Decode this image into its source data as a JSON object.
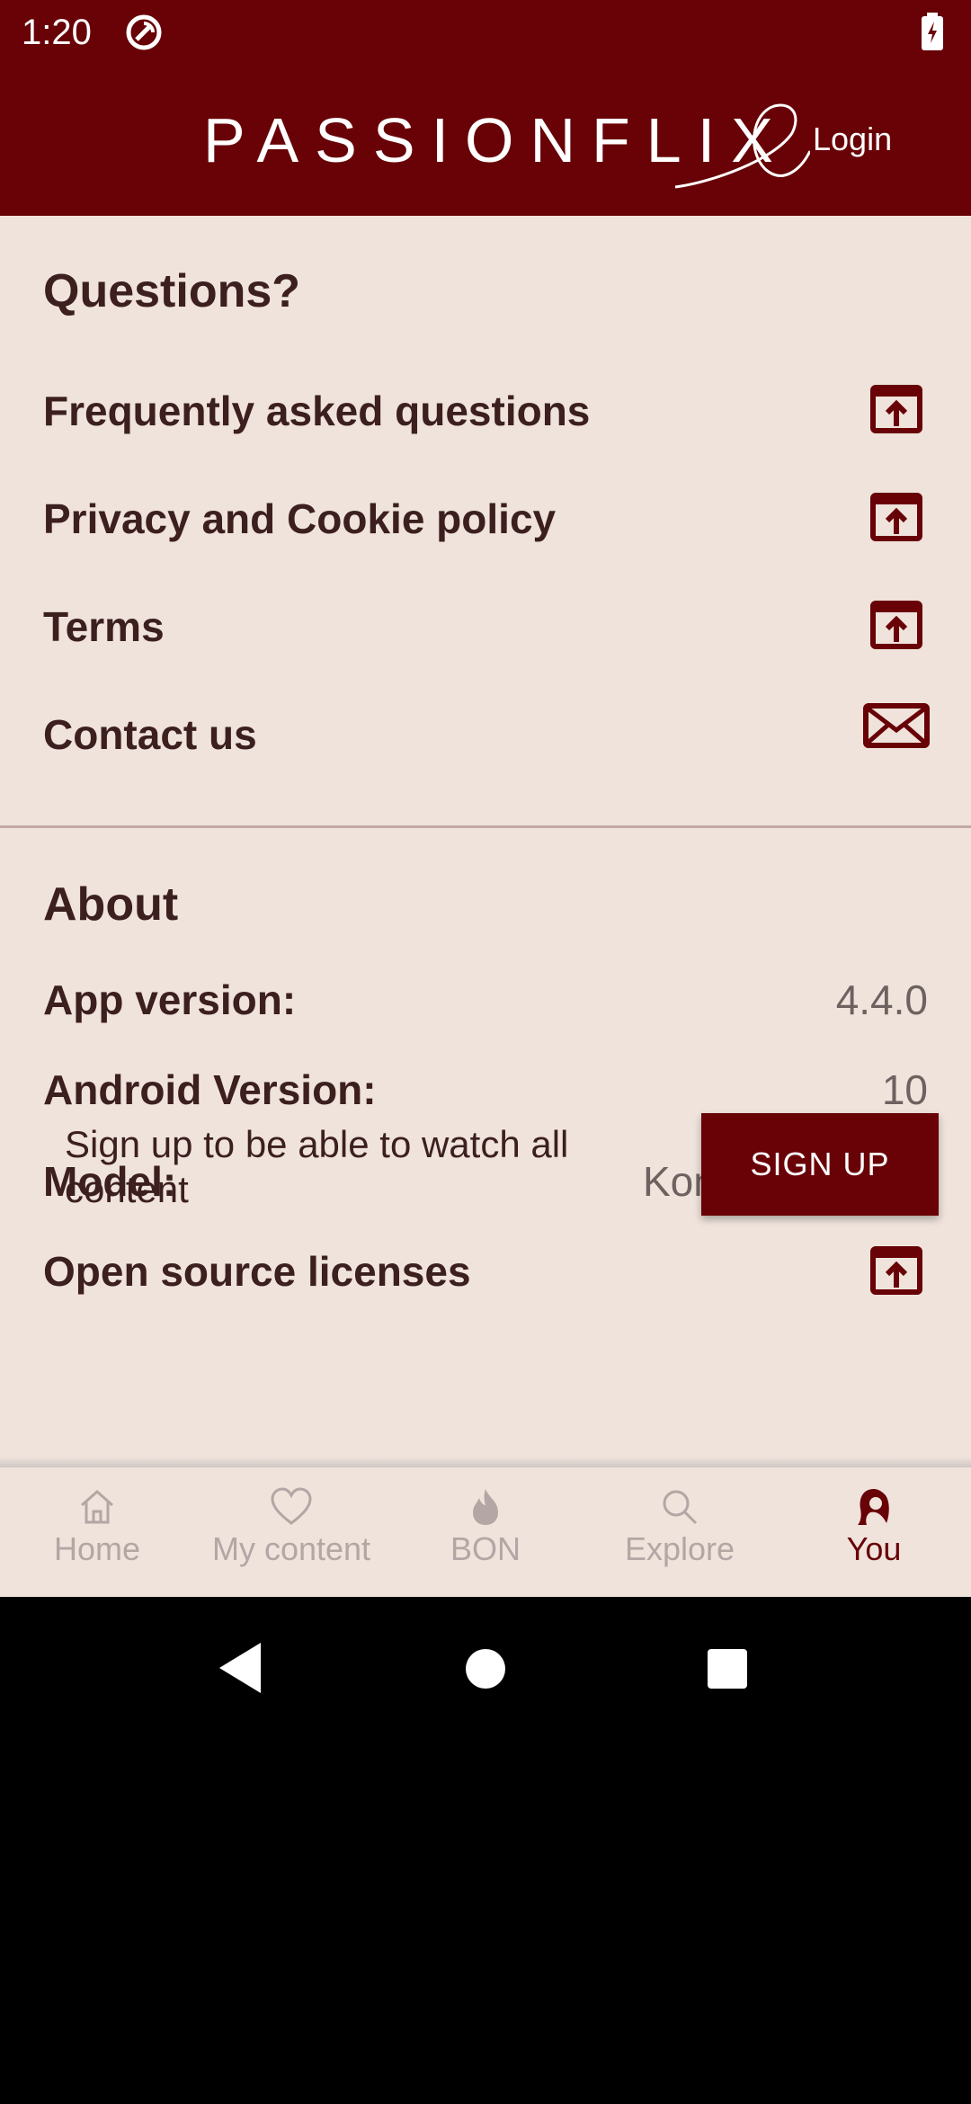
{
  "status_bar": {
    "time": "1:20"
  },
  "header": {
    "logo_text": "PASSIONFLIX",
    "login_label": "Login"
  },
  "questions": {
    "title": "Questions?",
    "items": [
      {
        "label": "Frequently asked questions",
        "icon": "open-external-icon"
      },
      {
        "label": "Privacy and Cookie policy",
        "icon": "open-external-icon"
      },
      {
        "label": "Terms",
        "icon": "open-external-icon"
      },
      {
        "label": "Contact us",
        "icon": "mail-icon"
      }
    ]
  },
  "about": {
    "title": "About",
    "app_version_label": "App version:",
    "app_version": "4.4.0",
    "android_version_label": "Android Version:",
    "android_version": "10",
    "model_label": "Model:",
    "model": "Kona for arm64",
    "licenses_label": "Open source licenses"
  },
  "signup_banner": {
    "text": "Sign up to be able to watch all content",
    "button_label": "SIGN UP"
  },
  "tabs": [
    {
      "label": "Home",
      "icon": "home-icon",
      "active": false
    },
    {
      "label": "My content",
      "icon": "heart-icon",
      "active": false
    },
    {
      "label": "BON",
      "icon": "flame-icon",
      "active": false
    },
    {
      "label": "Explore",
      "icon": "search-icon",
      "active": false
    },
    {
      "label": "You",
      "icon": "profile-icon",
      "active": true
    }
  ],
  "colors": {
    "brand": "#680206",
    "background": "#efe3dc",
    "text": "#3c1f1f",
    "muted": "#b3a6a4"
  }
}
